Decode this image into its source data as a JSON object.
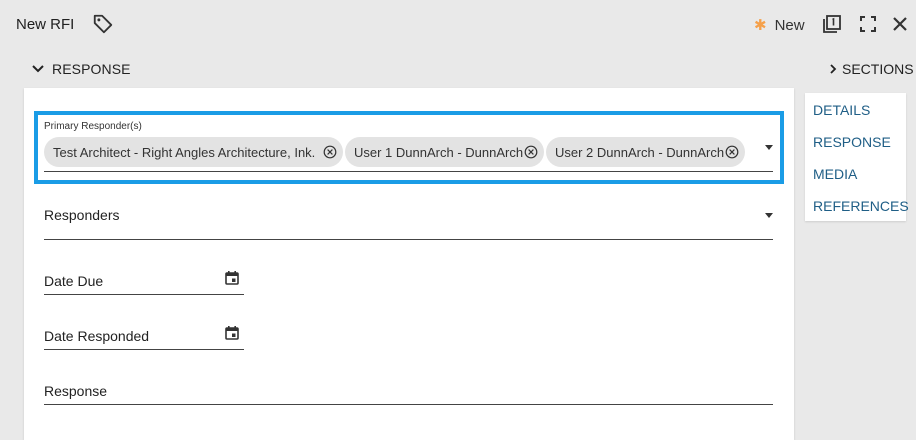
{
  "header": {
    "title": "New RFI",
    "new_label": "New",
    "icons": [
      "tag-icon",
      "copy-icon",
      "fullscreen-icon",
      "close-icon"
    ]
  },
  "section": {
    "title": "RESPONSE"
  },
  "sections_panel": {
    "toggle_label": "SECTIONS",
    "items": [
      "DETAILS",
      "RESPONSE",
      "MEDIA",
      "REFERENCES"
    ]
  },
  "form": {
    "primary_responders": {
      "label": "Primary Responder(s)",
      "chips": [
        "Test Architect - Right Angles Architecture, Ink.",
        "User 1 DunnArch - DunnArch",
        "User 2 DunnArch - DunnArch"
      ]
    },
    "responders_label": "Responders",
    "date_due_label": "Date Due",
    "date_responded_label": "Date Responded",
    "response_label": "Response"
  },
  "colors": {
    "accent_blue": "#1a9ce6",
    "link_blue": "#1f5e86",
    "star_orange": "#f5a04a",
    "background": "#e9e9e9"
  }
}
